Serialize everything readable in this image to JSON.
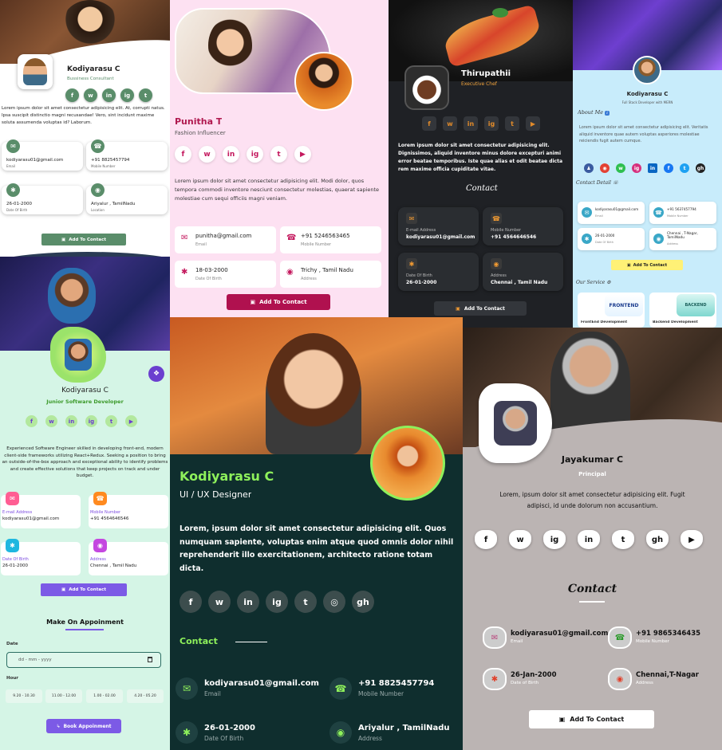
{
  "card1": {
    "name": "Kodiyarasu C",
    "role": "Bussiness Consultant",
    "bio": "Lorem ipsum dolor sit amet consectetur adipisicing elit. At, corrupti natus. Ipsa suscipit distinctio magni recusandae! Vero, sint incidunt maxime soluta assumenda voluptas id? Laborum.",
    "email": "kodiyarasu01@gmail.com",
    "email_label": "Email",
    "mobile": "+91 8825457794",
    "mobile_label": "Mobile Number",
    "dob": "26-01-2000",
    "dob_label": "Date Of Birth",
    "address": "Ariyalur , TamilNadu",
    "address_label": "Location",
    "button": "Add To Contact"
  },
  "card2": {
    "name": "Punitha T",
    "role": "Fashion Influencer",
    "bio": "Lorem ipsum dolor sit amet consectetur adipisicing elit. Modi dolor, quos tempora commodi inventore nesciunt consectetur molestias, quaerat sapiente molestiae cum sequi officiis magni veniam.",
    "email": "punitha@gmail.com",
    "email_label": "Email",
    "mobile": "+91 5246563465",
    "mobile_label": "Mobile Number",
    "dob": "18-03-2000",
    "dob_label": "Date Of Birth",
    "address": "Trichy , Tamil Nadu",
    "address_label": "Address",
    "button": "Add To Contact"
  },
  "card3": {
    "name": "Thirupathii",
    "role": "Executive Chef",
    "bio": "Lorem ipsum dolor sit amet consectetur adipisicing elit. Dignissimos, aliquid inventore minus dolore excepturi animi error beatae temporibus. Iste quae alias et odit beatae dicta rem maxime officia cupiditate vitae.",
    "contact_title": "Contact",
    "email": "kodiyarasu01@gmail.com",
    "email_label": "E-mail Address",
    "mobile": "+91 4564646546",
    "mobile_label": "Mobile Number",
    "dob": "26-01-2000",
    "dob_label": "Date Of Birth",
    "address": "Chennai , Tamil Nadu",
    "address_label": "Address",
    "button": "Add To Contact"
  },
  "card4": {
    "name": "Kodiyarasu C",
    "role": "Full Stack Developer with MERN",
    "about_title": "About Me",
    "bio": "Lorem ipsum dolor sit amet consectetur adipisicing elit. Veritatis aliquid inventore quae autem voluptas asperiores molestiae reiciendis fugit autem cumque.",
    "contact_title": "Contact Detail",
    "email": "kodiyarasu01@gmail.com",
    "email_label": "Email",
    "mobile": "+91 5637457794",
    "mobile_label": "Mobile Number",
    "dob": "26-01-2000",
    "dob_label": "Date Of Birth",
    "address": "Chennai , T-Nagar, TamilNadu",
    "address_label": "Address",
    "button": "Add To Contact",
    "service_title": "Our Service",
    "service1": "FrontEnd Development",
    "service2": "Backend Development",
    "service1_art": "FRONTEND",
    "service2_art": "BACKEND"
  },
  "card5": {
    "name": "Kodiyarasu C",
    "role": "Junior Software Developer",
    "bio": "Experienced Software Engineer skilled in developing front-end, modern client-side frameworks utilizing React+Redux. Seeking a position to bring an outside-of-the-box approach and exceptional ability to identify problems and create effective solutions that keep projects on track and under budget.",
    "email": "kodiyarasu01@gmail.com",
    "email_label": "E-mail Address",
    "mobile": "+91 4564646546",
    "mobile_label": "Mobile Number",
    "dob": "26-01-2000",
    "dob_label": "Date Of Birth",
    "address": "Chennai , Tamil Nadu",
    "address_label": "Address",
    "button": "Add To Contact",
    "appointment_title": "Make On Appoinment",
    "date_label": "Date",
    "date_placeholder": "dd - mm - yyyy",
    "hour_label": "Hour",
    "slots": [
      "9.20 - 10.30",
      "11.00 - 12.00",
      "1.00 - 02.00",
      "4.20 - 05.20"
    ],
    "book_button": "Book Appoinment"
  },
  "card6": {
    "name": "Kodiyarasu C",
    "role": "UI / UX Designer",
    "bio": "Lorem, ipsum dolor sit amet consectetur adipisicing elit. Quos numquam sapiente, voluptas enim atque quod omnis dolor nihil reprehenderit illo exercitationem, architecto ratione totam dicta.",
    "contact_title": "Contact",
    "email": "kodiyarasu01@gmail.com",
    "email_label": "Email",
    "mobile": "+91 8825457794",
    "mobile_label": "Mobile Number",
    "dob": "26-01-2000",
    "dob_label": "Date Of Birth",
    "address": "Ariyalur , TamilNadu",
    "address_label": "Address",
    "accent": "#8ef05b"
  },
  "card7": {
    "name": "Jayakumar C",
    "role": "Principal",
    "bio": "Lorem, ipsum dolor sit amet consectetur adipisicing elit. Fugit adipisci, id unde dolorum non accusantium.",
    "contact_title": "Contact",
    "email": "kodiyarasu01@gmail.com",
    "email_label": "Email",
    "mobile": "+91 9865346435",
    "mobile_label": "Mobile Number",
    "dob": "26-Jan-2000",
    "dob_label": "Date of Birth",
    "address": "Chennai,T-Nagar",
    "address_label": "Address",
    "button": "Add To Contact"
  },
  "icons": {
    "facebook": "f",
    "whatsapp": "w",
    "linkedin": "in",
    "instagram": "ig",
    "twitter": "t",
    "youtube": "▶",
    "github": "gh",
    "globe": "◎",
    "mail": "✉",
    "phone": "☎",
    "cake": "✱",
    "pin": "◉",
    "save": "▣"
  }
}
